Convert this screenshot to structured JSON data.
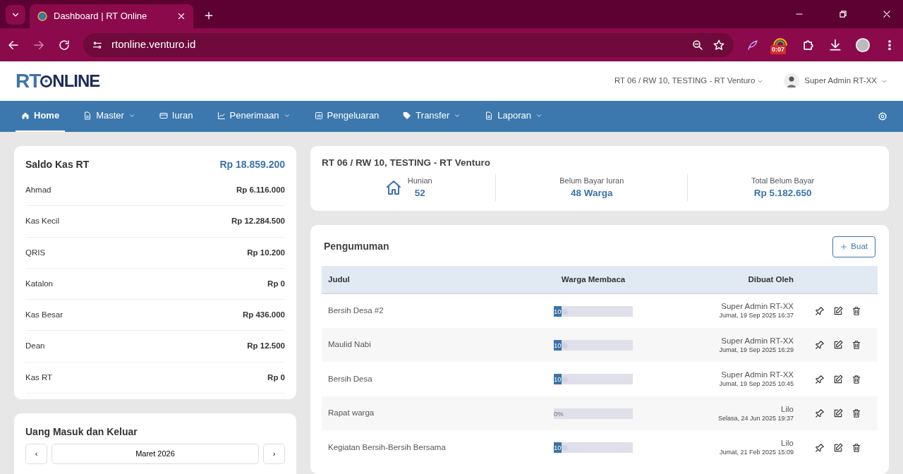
{
  "browser": {
    "tab_title": "Dashboard | RT Online",
    "url": "rtonline.venturo.id",
    "extension_badge": "0:07"
  },
  "header": {
    "logo": {
      "left": "RT",
      "right": "NLINE"
    },
    "location": "RT 06 / RW 10, TESTING - RT Venturo",
    "user": "Super Admin RT-XX"
  },
  "nav": [
    {
      "label": "Home",
      "dropdown": false,
      "selected": true
    },
    {
      "label": "Master",
      "dropdown": true,
      "selected": false
    },
    {
      "label": "Iuran",
      "dropdown": false,
      "selected": false
    },
    {
      "label": "Penerimaan",
      "dropdown": true,
      "selected": false
    },
    {
      "label": "Pengeluaran",
      "dropdown": false,
      "selected": false
    },
    {
      "label": "Transfer",
      "dropdown": true,
      "selected": false
    },
    {
      "label": "Laporan",
      "dropdown": true,
      "selected": false
    }
  ],
  "saldo": {
    "title": "Saldo Kas RT",
    "total": "Rp 18.859.200",
    "accounts": [
      {
        "name": "Ahmad",
        "amount": "Rp 6.116.000"
      },
      {
        "name": "Kas Kecil",
        "amount": "Rp 12.284.500"
      },
      {
        "name": "QRIS",
        "amount": "Rp 10.200"
      },
      {
        "name": "Katalon",
        "amount": "Rp 0"
      },
      {
        "name": "Kas Besar",
        "amount": "Rp 436.000"
      },
      {
        "name": "Dean",
        "amount": "Rp 12.500"
      },
      {
        "name": "Kas RT",
        "amount": "Rp 0"
      }
    ]
  },
  "cashflow": {
    "title": "Uang Masuk dan Keluar",
    "prev": "‹",
    "month": "Maret 2026",
    "next": "›"
  },
  "summary": {
    "title": "RT 06 / RW 10, TESTING - RT Venturo",
    "stats": [
      {
        "label": "Hunian",
        "value": "52",
        "kind": "icon"
      },
      {
        "label": "Belum Bayar Iuran",
        "value": "48 Warga",
        "kind": "plain"
      },
      {
        "label": "Total Belum Bayar",
        "value": "Rp 5.182.650",
        "kind": "plain"
      }
    ]
  },
  "announcements": {
    "title": "Pengumuman",
    "create_button": "Buat",
    "columns": [
      "Judul",
      "Warga Membaca",
      "Dibuat Oleh"
    ],
    "rows": [
      {
        "title": "Bersih Desa #2",
        "level": 0.1,
        "reading": "10%",
        "author": "Super Admin RT-XX",
        "date": "Jumat, 19 Sep 2025 16:37"
      },
      {
        "title": "Maulid Nabi",
        "level": 0.1,
        "reading": "10%",
        "author": "Super Admin RT-XX",
        "date": "Jumat, 19 Sep 2025 16:29"
      },
      {
        "title": "Bersih Desa",
        "level": 0.1,
        "reading": "10%",
        "author": "Super Admin RT-XX",
        "date": "Jumat, 19 Sep 2025 10:45"
      },
      {
        "title": "Rapat warga",
        "level": 0,
        "reading": "0%",
        "author": "Lilo",
        "date": "Selasa, 24 Jun 2025 19:37"
      },
      {
        "title": "Kegiatan Bersih-Bersih Bersama",
        "level": 0.1,
        "reading": "10%",
        "author": "Lilo",
        "date": "Jumat, 21 Feb 2025 15:09"
      }
    ]
  }
}
